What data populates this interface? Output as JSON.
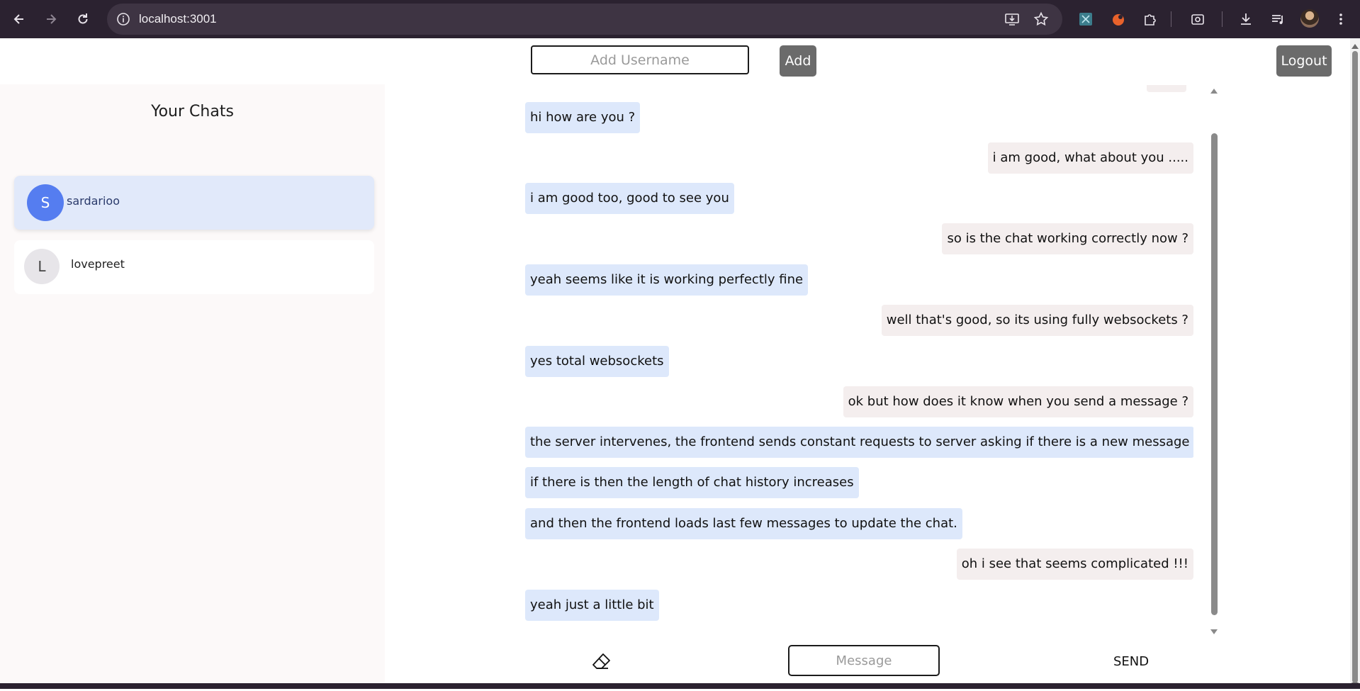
{
  "browser": {
    "url": "localhost:3001"
  },
  "header": {
    "username_placeholder": "Add Username",
    "add_label": "Add",
    "logout_label": "Logout"
  },
  "sidebar": {
    "title": "Your Chats",
    "chats": [
      {
        "initial": "S",
        "name": "sardarioo",
        "active": true
      },
      {
        "initial": "L",
        "name": "lovepreet",
        "active": false
      }
    ]
  },
  "messages": [
    {
      "text": "hi how are you ?",
      "from": "received"
    },
    {
      "text": "i am good, what about you .....",
      "from": "sent"
    },
    {
      "text": "i am good too, good to see you",
      "from": "received"
    },
    {
      "text": "so is the chat working correctly now ?",
      "from": "sent"
    },
    {
      "text": "yeah seems like it is working perfectly fine",
      "from": "received"
    },
    {
      "text": "well that's good, so its using fully websockets ?",
      "from": "sent"
    },
    {
      "text": "yes total websockets",
      "from": "received"
    },
    {
      "text": "ok but how does it know when you send a message ?",
      "from": "sent"
    },
    {
      "text": "the server intervenes, the frontend sends constant requests to server asking if there is a new message",
      "from": "received"
    },
    {
      "text": "if there is then the length of chat history increases",
      "from": "received"
    },
    {
      "text": "and then the frontend loads last few messages to update the chat.",
      "from": "received"
    },
    {
      "text": "oh i see that seems complicated !!!",
      "from": "sent"
    },
    {
      "text": "yeah just a little bit",
      "from": "received"
    }
  ],
  "composer": {
    "message_placeholder": "Message",
    "send_label": "SEND"
  },
  "colors": {
    "browser_bg": "#2b2230",
    "received_bubble": "#dde8fb",
    "sent_bubble": "#f4eeee",
    "active_chat": "#e1e9fa",
    "avatar_active": "#557df0",
    "button_gray": "#6b6b6b"
  }
}
